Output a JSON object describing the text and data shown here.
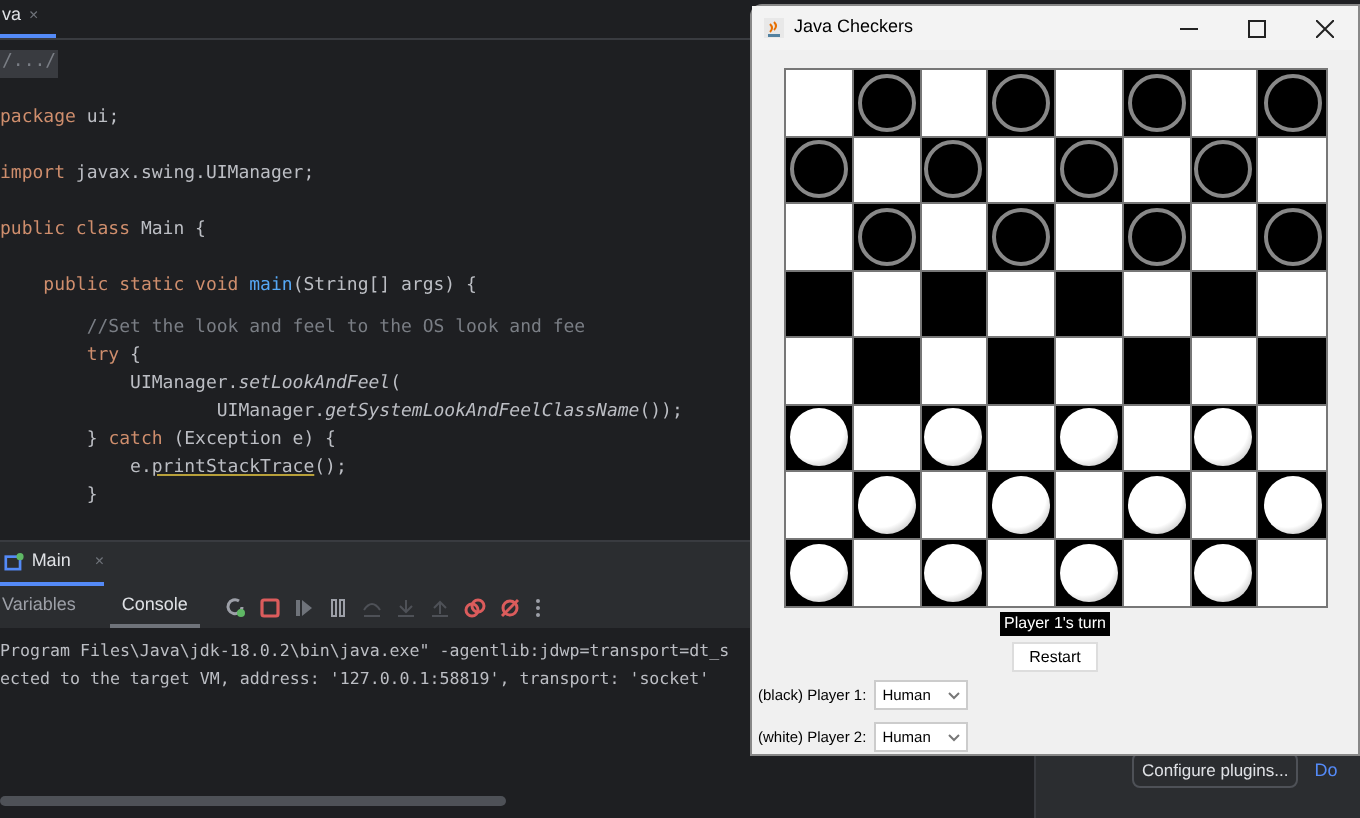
{
  "editor": {
    "tab": {
      "label": "va",
      "close": "×"
    },
    "fold": "/.../",
    "lines": [
      [
        {
          "text": "package",
          "kind": "keyword"
        },
        {
          "text": " ui;",
          "kind": "plain"
        }
      ],
      [
        {
          "text": "import",
          "kind": "keyword"
        },
        {
          "text": " javax.swing.UIManager;",
          "kind": "plain"
        }
      ],
      [
        {
          "text": "public class",
          "kind": "keyword"
        },
        {
          "text": " Main {",
          "kind": "plain"
        }
      ],
      [
        {
          "text": "    public static void",
          "kind": "keyword"
        },
        {
          "text": " main",
          "kind": "method"
        },
        {
          "text": "(String[] args) {",
          "kind": "plain"
        }
      ]
    ],
    "block": [
      [
        {
          "text": "        //Set the look and feel to the OS look and fee",
          "kind": "comment"
        }
      ],
      [
        {
          "text": "        try",
          "kind": "keyword"
        },
        {
          "text": " {",
          "kind": "plain"
        }
      ],
      [
        {
          "text": "            UIManager.",
          "kind": "plain"
        },
        {
          "text": "setLookAndFeel",
          "kind": "static"
        },
        {
          "text": "(",
          "kind": "plain"
        }
      ],
      [
        {
          "text": "                    UIManager.",
          "kind": "plain"
        },
        {
          "text": "getSystemLookAndFeelClassName",
          "kind": "static"
        },
        {
          "text": "());",
          "kind": "plain"
        }
      ],
      [
        {
          "text": "        } ",
          "kind": "plain"
        },
        {
          "text": "catch",
          "kind": "keyword"
        },
        {
          "text": " (Exception e) {",
          "kind": "plain"
        }
      ],
      [
        {
          "text": "            e.",
          "kind": "plain"
        },
        {
          "text": "printStackTrace",
          "kind": "warn"
        },
        {
          "text": "();",
          "kind": "plain"
        }
      ],
      [
        {
          "text": "        }",
          "kind": "plain"
        }
      ]
    ]
  },
  "run_panel": {
    "tab": {
      "label": "Main",
      "close": "×"
    },
    "tabs": [
      {
        "label": "Variables",
        "selected": false
      },
      {
        "label": "Console",
        "selected": true
      }
    ],
    "console": [
      "Program Files\\Java\\jdk-18.0.2\\bin\\java.exe\" -agentlib:jdwp=transport=dt_s",
      "ected to the target VM, address: '127.0.0.1:58819', transport: 'socket'"
    ]
  },
  "plugins_button": "Configure plugins...",
  "plugins_link": "Do",
  "window": {
    "title": "Java Checkers",
    "board": [
      [
        {
          "kind": "empty"
        },
        {
          "kind": "black"
        },
        {
          "kind": "empty"
        },
        {
          "kind": "black"
        },
        {
          "kind": "empty"
        },
        {
          "kind": "black"
        },
        {
          "kind": "empty"
        },
        {
          "kind": "black"
        }
      ],
      [
        {
          "kind": "black"
        },
        {
          "kind": "empty"
        },
        {
          "kind": "black"
        },
        {
          "kind": "empty"
        },
        {
          "kind": "black"
        },
        {
          "kind": "empty"
        },
        {
          "kind": "black"
        },
        {
          "kind": "empty"
        }
      ],
      [
        {
          "kind": "empty"
        },
        {
          "kind": "black"
        },
        {
          "kind": "empty"
        },
        {
          "kind": "black"
        },
        {
          "kind": "empty"
        },
        {
          "kind": "black"
        },
        {
          "kind": "empty"
        },
        {
          "kind": "black"
        }
      ],
      [
        {
          "kind": "empty"
        },
        {
          "kind": "empty"
        },
        {
          "kind": "empty"
        },
        {
          "kind": "empty"
        },
        {
          "kind": "empty"
        },
        {
          "kind": "empty"
        },
        {
          "kind": "empty"
        },
        {
          "kind": "empty"
        }
      ],
      [
        {
          "kind": "empty"
        },
        {
          "kind": "empty"
        },
        {
          "kind": "empty"
        },
        {
          "kind": "empty"
        },
        {
          "kind": "empty"
        },
        {
          "kind": "empty"
        },
        {
          "kind": "empty"
        },
        {
          "kind": "empty"
        }
      ],
      [
        {
          "kind": "white"
        },
        {
          "kind": "empty"
        },
        {
          "kind": "white"
        },
        {
          "kind": "empty"
        },
        {
          "kind": "white"
        },
        {
          "kind": "empty"
        },
        {
          "kind": "white"
        },
        {
          "kind": "empty"
        }
      ],
      [
        {
          "kind": "empty"
        },
        {
          "kind": "white"
        },
        {
          "kind": "empty"
        },
        {
          "kind": "white"
        },
        {
          "kind": "empty"
        },
        {
          "kind": "white"
        },
        {
          "kind": "empty"
        },
        {
          "kind": "white"
        }
      ],
      [
        {
          "kind": "white"
        },
        {
          "kind": "empty"
        },
        {
          "kind": "white"
        },
        {
          "kind": "empty"
        },
        {
          "kind": "white"
        },
        {
          "kind": "empty"
        },
        {
          "kind": "white"
        },
        {
          "kind": "empty"
        }
      ]
    ],
    "status": "Player 1's turn",
    "restart": "Restart",
    "players": [
      {
        "label": "(black) Player 1:",
        "value": "Human"
      },
      {
        "label": "(white) Player 2:",
        "value": "Human"
      }
    ]
  }
}
